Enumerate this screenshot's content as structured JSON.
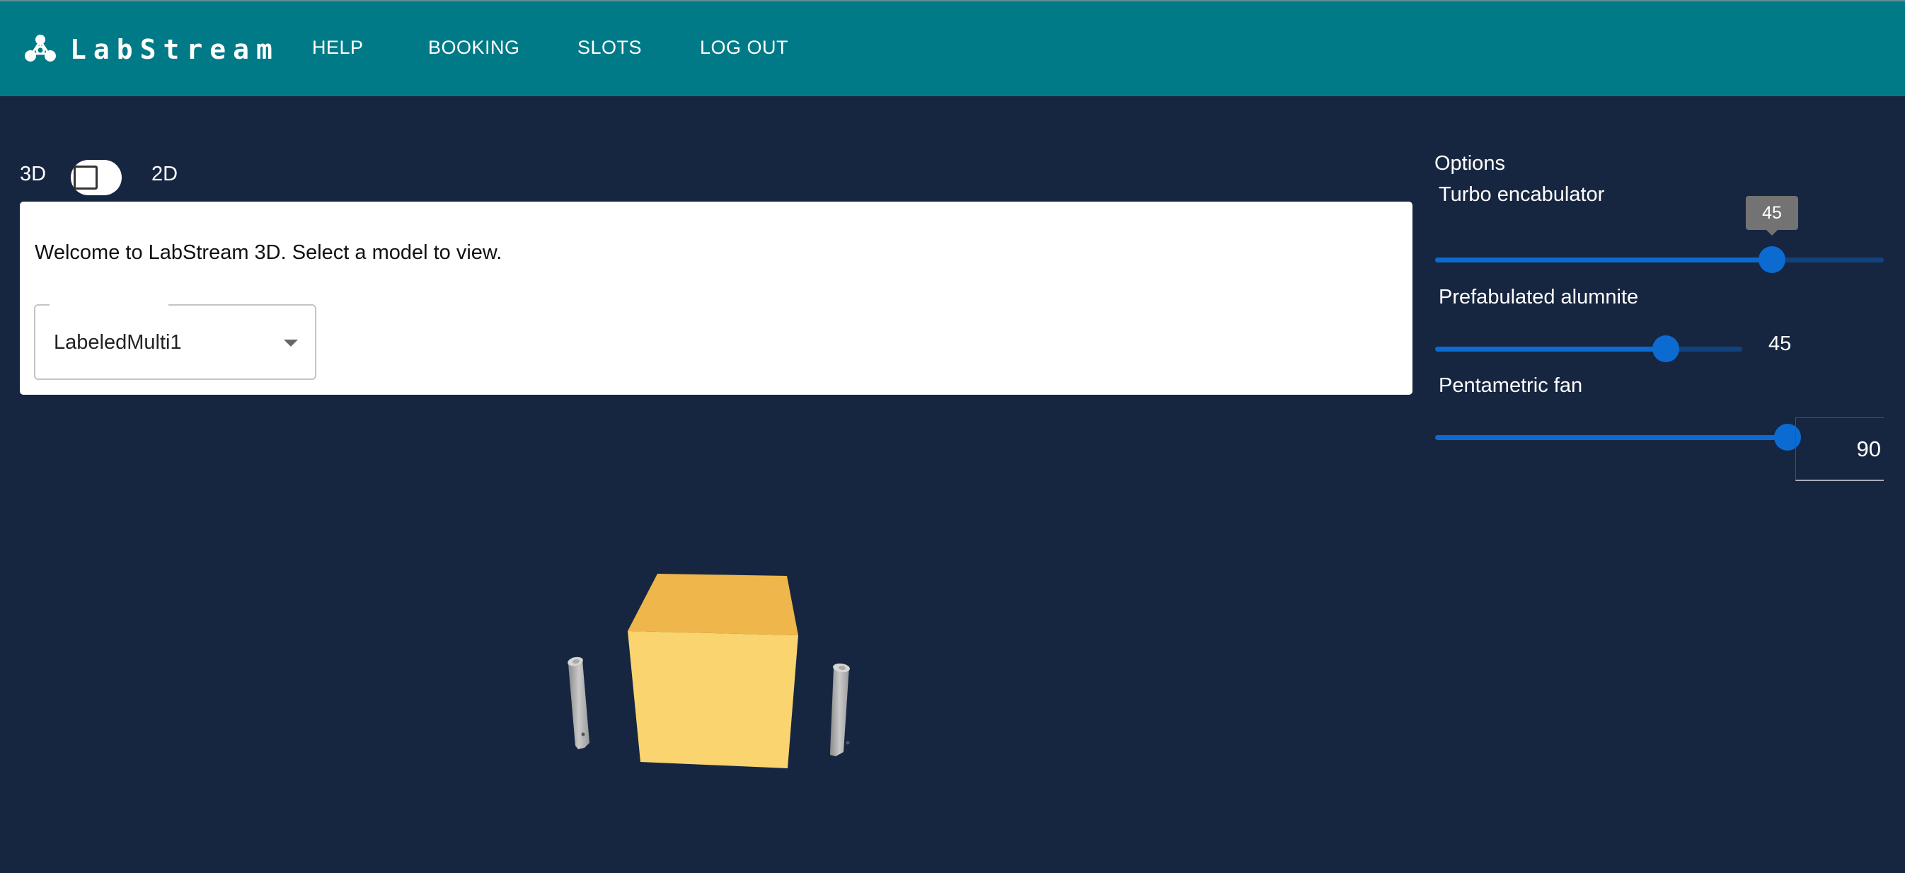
{
  "app": {
    "logo_text": "LabStream",
    "logo_icon": "molecule-icon"
  },
  "nav": {
    "items": [
      {
        "label": "HELP"
      },
      {
        "label": "BOOKING"
      },
      {
        "label": "SLOTS"
      },
      {
        "label": "LOG OUT"
      }
    ]
  },
  "view_toggle": {
    "left_label": "3D",
    "right_label": "2D",
    "checked": false
  },
  "card": {
    "welcome_text": "Welcome to LabStream 3D. Select a model to view.",
    "model_select": {
      "value": "LabeledMulti1",
      "icon": "chevron-down-icon"
    }
  },
  "viewport": {
    "objects": [
      "yellow-cube",
      "grey-cylinder-left",
      "grey-cylinder-right"
    ],
    "cube_color": "#f7cf60",
    "cylinder_color": "#9e9e9e"
  },
  "options": {
    "title": "Options",
    "sliders": [
      {
        "label": "Turbo encabulator",
        "value": 45,
        "fraction": 0.75,
        "value_display": "tooltip",
        "tooltip": "45"
      },
      {
        "label": "Prefabulated alumnite",
        "value": 45,
        "fraction": 0.75,
        "value_display": "text",
        "value_text": "45"
      },
      {
        "label": "Pentametric fan",
        "value": 90,
        "fraction": 1.0,
        "value_display": "input",
        "input_value": "90"
      }
    ]
  },
  "colors": {
    "header_bg": "#007a87",
    "page_bg": "#172640",
    "slider_accent": "#0b6bd1",
    "slider_track": "#10437d"
  }
}
